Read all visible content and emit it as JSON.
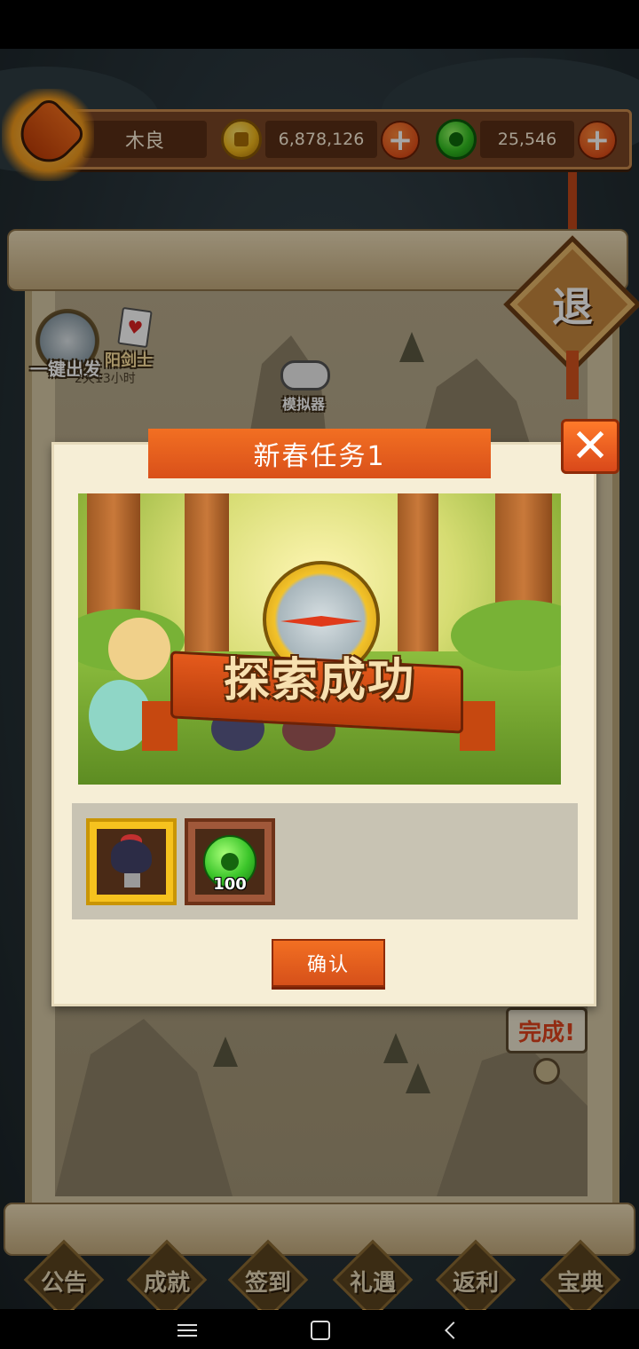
{
  "player": {
    "name": "木良",
    "gold": "6,878,126",
    "jade": "25,546"
  },
  "map": {
    "exit_label": "退",
    "one_click_label": "一键出发",
    "hero_label": "阳剑士",
    "timer": "2天13小时",
    "simulator_label": "模拟器",
    "done_label": "完成!"
  },
  "dialog": {
    "title": "新春任务1",
    "banner_text": "探索成功",
    "rewards": [
      {
        "icon": "bird-statue-icon",
        "count": ""
      },
      {
        "icon": "jade-coin-icon",
        "count": "100"
      }
    ],
    "confirm_label": "确认",
    "close_label": "✕"
  },
  "bottom_menu": [
    {
      "label": "公告"
    },
    {
      "label": "成就"
    },
    {
      "label": "签到"
    },
    {
      "label": "礼遇"
    },
    {
      "label": "返利"
    },
    {
      "label": "宝典"
    }
  ],
  "colors": {
    "accent_orange": "#e4511a",
    "panel": "#f6eed6",
    "wood": "#7a4526"
  }
}
